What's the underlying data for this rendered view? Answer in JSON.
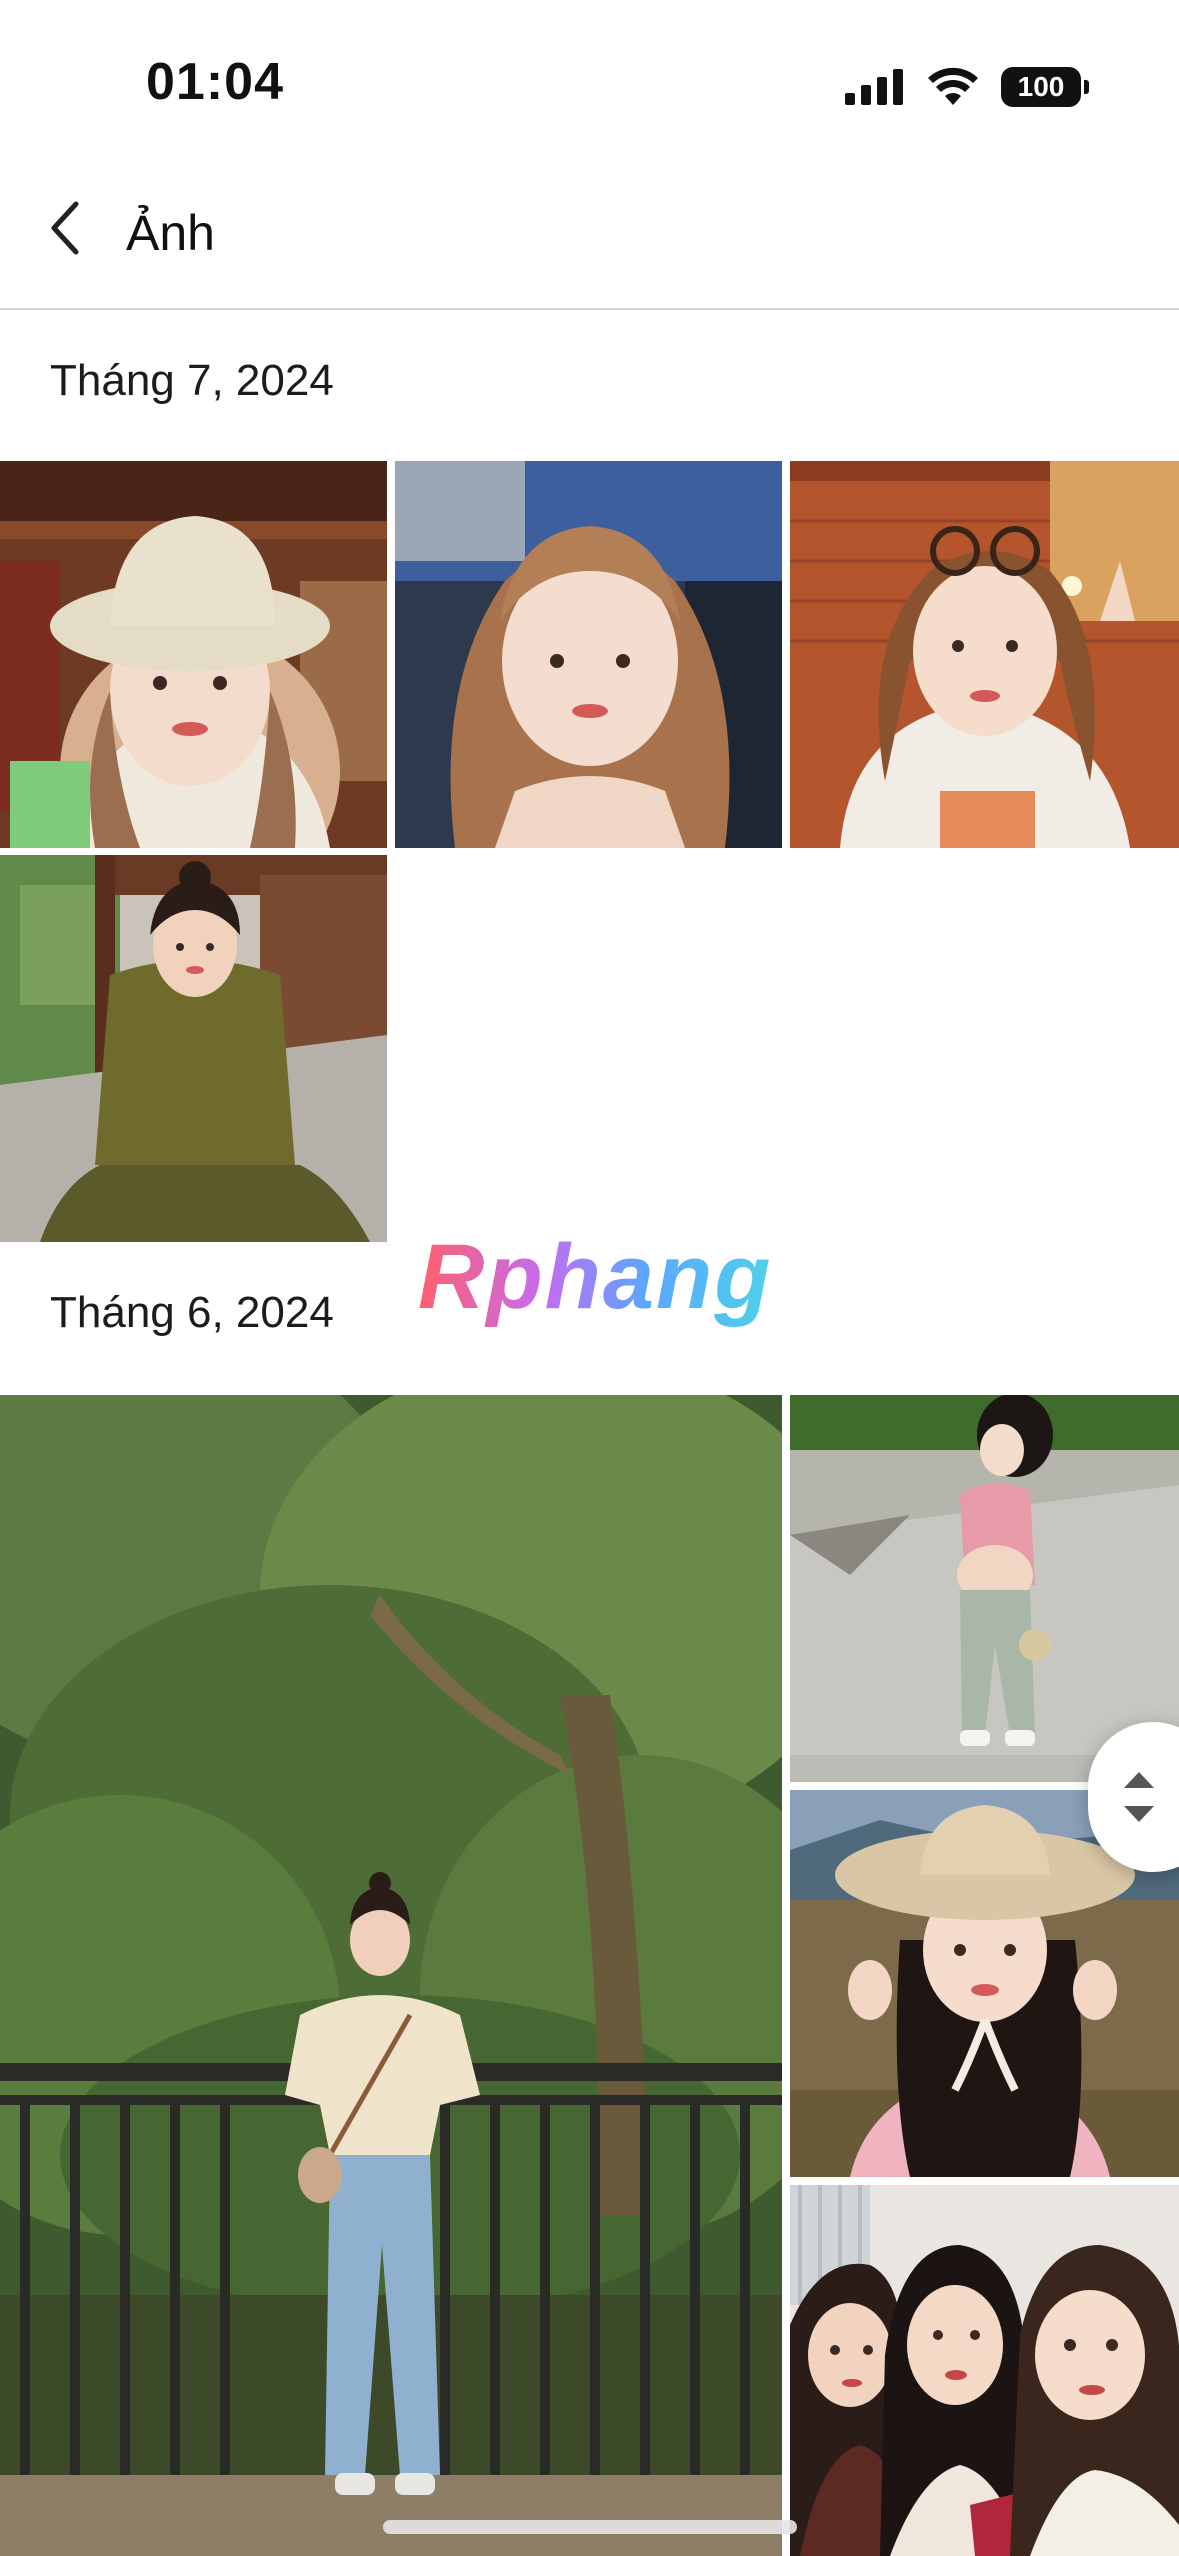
{
  "status_bar": {
    "time": "01:04",
    "battery": "100",
    "icons": [
      "signal-icon",
      "wifi-icon",
      "battery-icon"
    ]
  },
  "header": {
    "title": "Ảnh",
    "back_icon": "chevron-left-icon"
  },
  "sections": [
    {
      "title": "Tháng 7, 2024",
      "photo_count": 4
    },
    {
      "title": "Tháng 6, 2024",
      "photo_count": 4
    }
  ],
  "watermark": "Rphang",
  "scroll_handle_icons": [
    "chevron-up-icon",
    "chevron-down-icon"
  ],
  "colors": {
    "accent_text": "#1c1c1e",
    "divider": "#d6d6d8",
    "background": "#ffffff"
  }
}
